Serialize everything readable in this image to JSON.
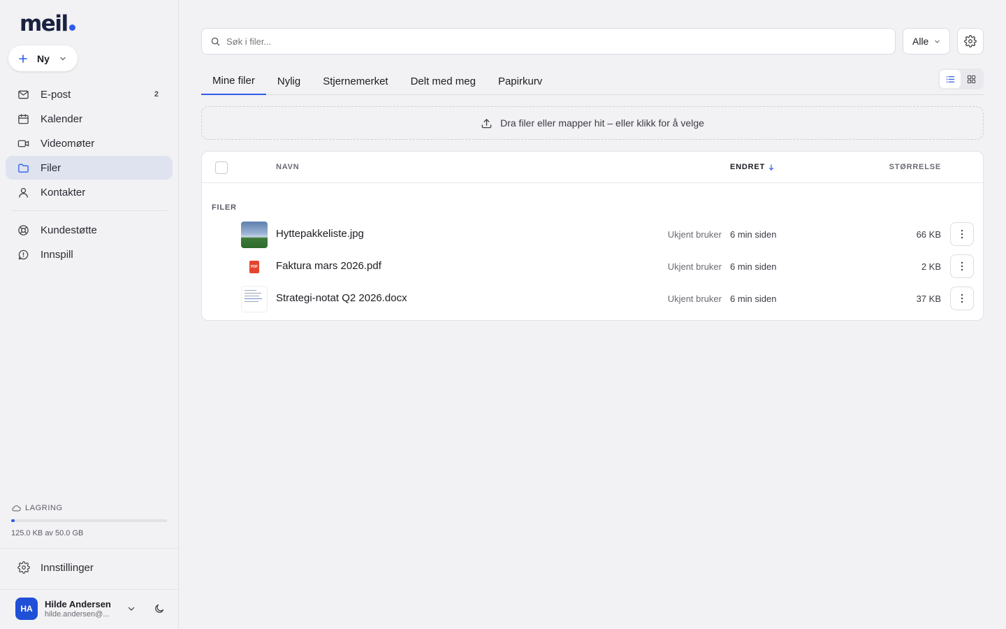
{
  "brand": {
    "name": "meil",
    "accent": "#2f5bea"
  },
  "sidebar": {
    "new_button": "Ny",
    "items": [
      {
        "label": "E-post",
        "icon": "mail-icon",
        "count": "2"
      },
      {
        "label": "Kalender",
        "icon": "calendar-icon"
      },
      {
        "label": "Videomøter",
        "icon": "video-icon"
      },
      {
        "label": "Filer",
        "icon": "folder-icon",
        "active": true
      },
      {
        "label": "Kontakter",
        "icon": "user-icon"
      },
      {
        "label": "Kundestøtte",
        "icon": "lifebuoy-icon"
      },
      {
        "label": "Innspill",
        "icon": "feedback-icon"
      }
    ],
    "storage": {
      "label": "LAGRING",
      "text": "125.0 KB av 50.0 GB",
      "used_fraction": 2.5e-06
    },
    "settings": "Innstillinger",
    "user": {
      "initials": "HA",
      "name": "Hilde Andersen",
      "email": "hilde.andersen@..."
    }
  },
  "search": {
    "placeholder": "Søk i filer...",
    "value": "",
    "filter": "Alle"
  },
  "tabs": [
    {
      "label": "Mine filer",
      "active": true
    },
    {
      "label": "Nylig"
    },
    {
      "label": "Stjernemerket"
    },
    {
      "label": "Delt med meg"
    },
    {
      "label": "Papirkurv"
    }
  ],
  "view_mode": "list",
  "dropzone": "Dra filer eller mapper hit – eller klikk for å velge",
  "table": {
    "headers": {
      "name": "NAVN",
      "changed": "ENDRET",
      "size": "STØRRELSE"
    },
    "section": "FILER",
    "rows": [
      {
        "name": "Hyttepakkeliste.jpg",
        "owner": "Ukjent bruker",
        "changed": "6 min siden",
        "size": "66 KB",
        "type": "image"
      },
      {
        "name": "Faktura mars 2026.pdf",
        "owner": "Ukjent bruker",
        "changed": "6 min siden",
        "size": "2 KB",
        "type": "pdf"
      },
      {
        "name": "Strategi-notat Q2 2026.docx",
        "owner": "Ukjent bruker",
        "changed": "6 min siden",
        "size": "37 KB",
        "type": "doc"
      }
    ]
  }
}
